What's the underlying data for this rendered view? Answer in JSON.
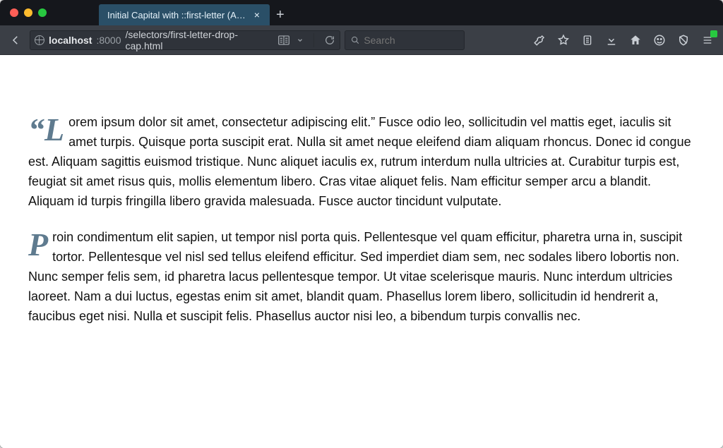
{
  "window": {
    "tab_title": "Initial Capital with ::first-letter (A…",
    "traffic": {
      "close": "close",
      "minimize": "minimize",
      "zoom": "zoom"
    }
  },
  "urlbar": {
    "host": "localhost",
    "port": ":8000",
    "path": "/selectors/first-letter-drop-cap.html"
  },
  "search": {
    "placeholder": "Search"
  },
  "content": {
    "p1": "“Lorem ipsum dolor sit amet, consectetur adipiscing elit.” Fusce odio leo, sollicitudin vel mattis eget, iaculis sit amet turpis. Quisque porta suscipit erat. Nulla sit amet neque eleifend diam aliquam rhoncus. Donec id congue est. Aliquam sagittis euismod tristique. Nunc aliquet iaculis ex, rutrum interdum nulla ultricies at. Curabitur turpis est, feugiat sit amet risus quis, mollis elementum libero. Cras vitae aliquet felis. Nam efficitur semper arcu a blandit. Aliquam id turpis fringilla libero gravida malesuada. Fusce auctor tincidunt vulputate.",
    "p2": "Proin condimentum elit sapien, ut tempor nisl porta quis. Pellentesque vel quam efficitur, pharetra urna in, suscipit tortor. Pellentesque vel nisl sed tellus eleifend efficitur. Sed imperdiet diam sem, nec sodales libero lobortis non. Nunc semper felis sem, id pharetra lacus pellentesque tempor. Ut vitae scelerisque mauris. Nunc interdum ultricies laoreet. Nam a dui luctus, egestas enim sit amet, blandit quam. Phasellus lorem libero, sollicitudin id hendrerit a, faucibus eget nisi. Nulla et suscipit felis. Phasellus auctor nisi leo, a bibendum turpis convallis nec."
  },
  "icons": {
    "back": "back",
    "reader": "reader",
    "dropdown": "dropdown",
    "reload": "reload",
    "search": "search",
    "dev": "devtools",
    "star": "bookmark-star",
    "clipboard": "clipboard",
    "download": "downloads",
    "home": "home",
    "smile": "pocket",
    "shield": "shield",
    "menu": "menu",
    "newtab": "+",
    "tabclose": "×"
  }
}
